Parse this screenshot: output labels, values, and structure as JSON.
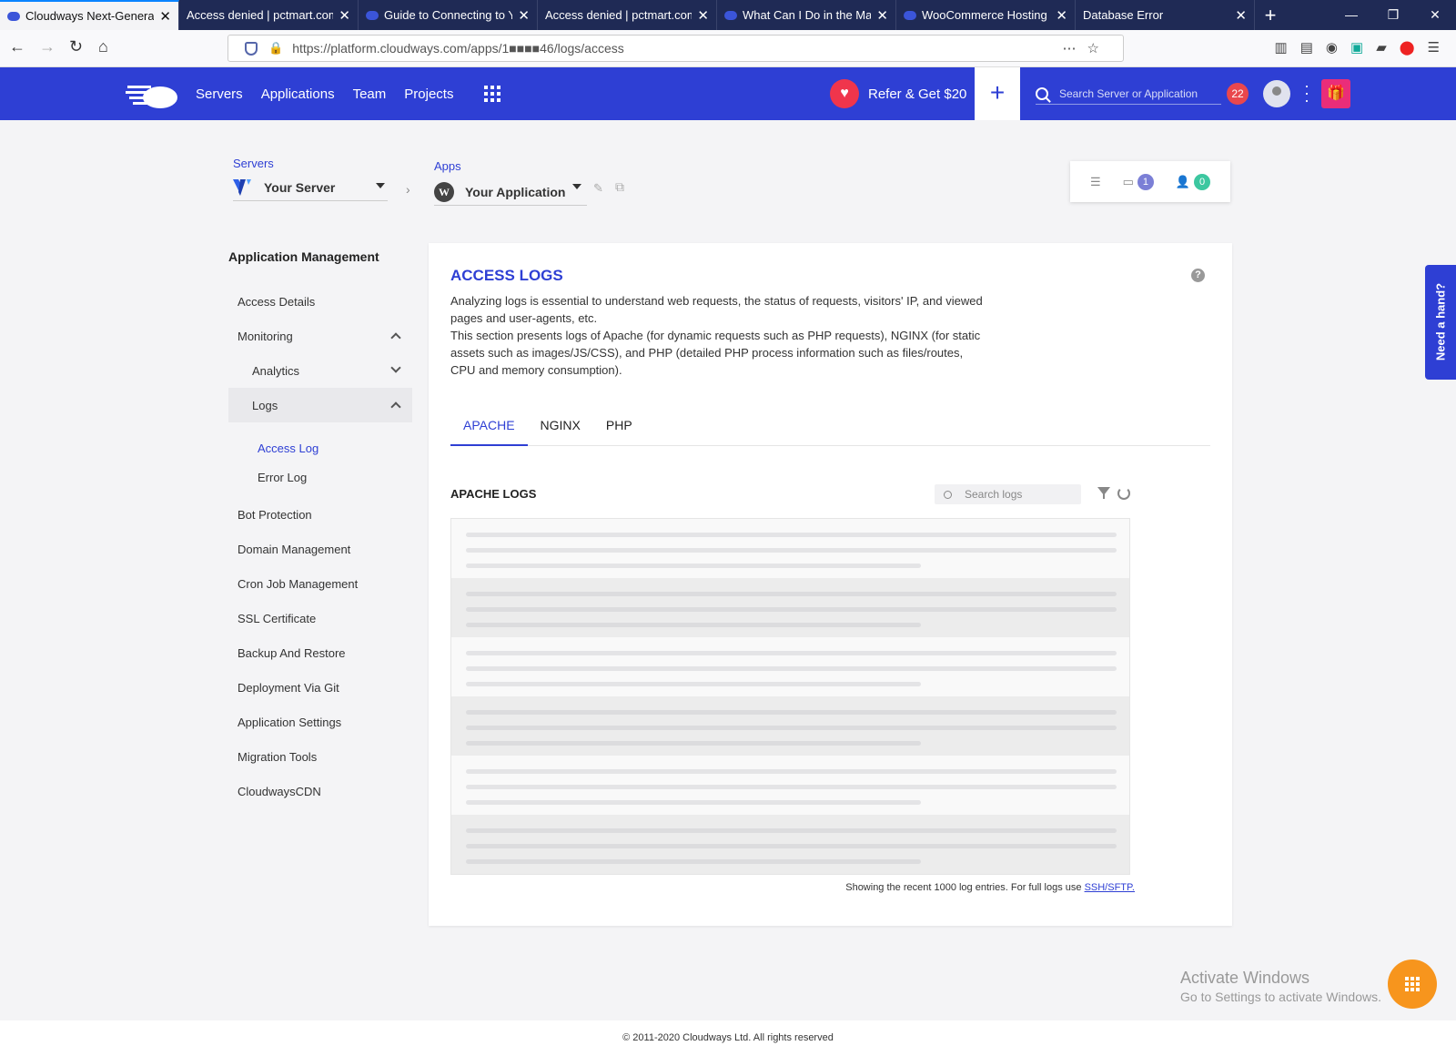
{
  "browser": {
    "tabs": [
      {
        "label": "Cloudways Next-Generati",
        "active": true
      },
      {
        "label": "Access denied | pctmart.com",
        "active": false
      },
      {
        "label": "Guide to Connecting to Yo",
        "active": false
      },
      {
        "label": "Access denied | pctmart.com",
        "active": false
      },
      {
        "label": "What Can I Do in the Man",
        "active": false
      },
      {
        "label": "WooCommerce Hosting -",
        "active": false
      },
      {
        "label": "Database Error",
        "active": false
      }
    ],
    "url": "https://platform.cloudways.com/apps/1■■■■46/logs/access"
  },
  "header": {
    "menu": [
      "Servers",
      "Applications",
      "Team",
      "Projects"
    ],
    "refer_label": "Refer & Get $20",
    "search_placeholder": "Search Server or Application",
    "notification_count": "22"
  },
  "breadcrumb": {
    "servers_label": "Servers",
    "server_name": "Your Server",
    "apps_label": "Apps",
    "app_name": "Your Application"
  },
  "quick_actions": {
    "files_count": "1",
    "members_count": "0"
  },
  "sidebar": {
    "title": "Application Management",
    "items": [
      {
        "label": "Access Details"
      },
      {
        "label": "Monitoring"
      },
      {
        "label": "Analytics"
      },
      {
        "label": "Logs"
      },
      {
        "label": "Access Log"
      },
      {
        "label": "Error Log"
      },
      {
        "label": "Bot Protection"
      },
      {
        "label": "Domain Management"
      },
      {
        "label": "Cron Job Management"
      },
      {
        "label": "SSL Certificate"
      },
      {
        "label": "Backup And Restore"
      },
      {
        "label": "Deployment Via Git"
      },
      {
        "label": "Application Settings"
      },
      {
        "label": "Migration Tools"
      },
      {
        "label": "CloudwaysCDN"
      }
    ]
  },
  "main": {
    "title": "ACCESS LOGS",
    "desc1": "Analyzing logs is essential to understand web requests, the status of requests, visitors' IP, and viewed pages and user-agents, etc.",
    "desc2": "This section presents logs of Apache (for dynamic requests such as PHP requests), NGINX (for static assets such as images/JS/CSS), and PHP (detailed PHP process information such as files/routes, CPU and memory consumption).",
    "tabs": [
      "APACHE",
      "NGINX",
      "PHP"
    ],
    "logs_heading": "APACHE LOGS",
    "search_placeholder": "Search logs",
    "footer_note": "Showing the recent 1000 log entries. For full logs use",
    "footer_link": "SSH/SFTP."
  },
  "help_tab": "Need a hand?",
  "watermark": {
    "line1": "Activate Windows",
    "line2": "Go to Settings to activate Windows."
  },
  "copyright": "© 2011-2020 Cloudways Ltd. All rights reserved"
}
